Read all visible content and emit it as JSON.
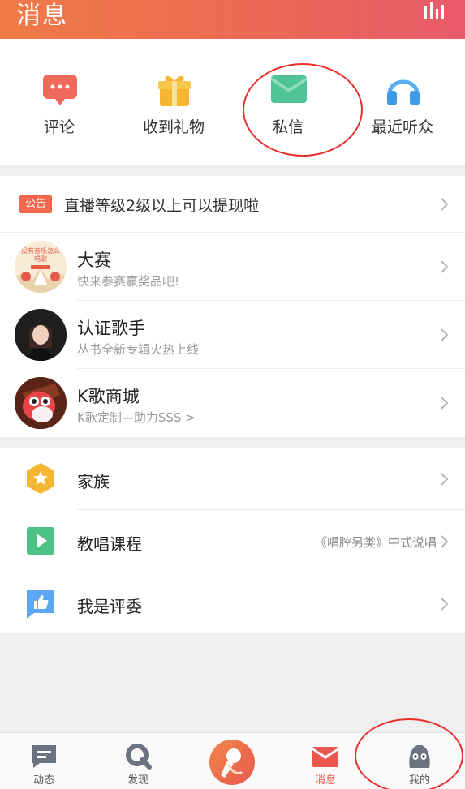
{
  "header": {
    "title": "消息",
    "icon": "stats-bars-icon"
  },
  "quick_entries": [
    {
      "label": "评论",
      "icon": "comment-bubble-icon",
      "color": "#ef6a5a"
    },
    {
      "label": "收到礼物",
      "icon": "gift-icon",
      "color": "#f5b731"
    },
    {
      "label": "私信",
      "icon": "envelope-icon",
      "color": "#4fc496"
    },
    {
      "label": "最近听众",
      "icon": "headphones-icon",
      "color": "#3f9be8"
    }
  ],
  "notice": {
    "badge": "公告",
    "text": "直播等级2级以上可以提现啦"
  },
  "feed": [
    {
      "title": "大赛",
      "subtitle": "快来参赛赢奖品吧!",
      "avatar_badge": "没有音乐怎么唱歌"
    },
    {
      "title": "认证歌手",
      "subtitle": "丛书全新专辑火热上线"
    },
    {
      "title": "K歌商城",
      "subtitle": "K歌定制—助力SSS >"
    }
  ],
  "menu": [
    {
      "label": "家族",
      "icon": "star-hexagon-icon",
      "extra": "",
      "color": "#f5b731"
    },
    {
      "label": "教唱课程",
      "icon": "play-icon",
      "extra": "《唱腔另类》中式说唱",
      "color": "#4cc286"
    },
    {
      "label": "我是评委",
      "icon": "thumbs-up-icon",
      "extra": "",
      "color": "#5da7f2"
    }
  ],
  "tabbar": {
    "tabs": [
      {
        "label": "动态",
        "icon": "feed-icon"
      },
      {
        "label": "发现",
        "icon": "discover-icon"
      },
      {
        "label": "",
        "icon": "sing-microphone-icon"
      },
      {
        "label": "消息",
        "icon": "message-envelope-icon",
        "active": true
      },
      {
        "label": "我的",
        "icon": "profile-penguin-icon"
      }
    ],
    "active_color": "#ec5d50"
  }
}
